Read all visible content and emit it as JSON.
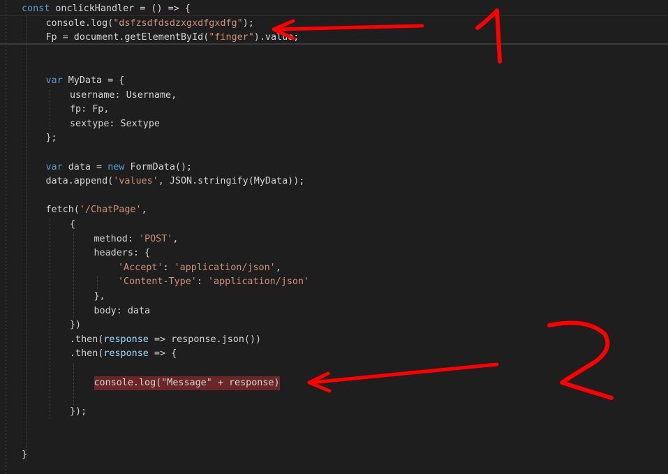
{
  "editor": {
    "lines": [
      {
        "indent": 0,
        "tokens": [
          {
            "t": "const ",
            "c": "kw"
          },
          {
            "t": "onclickHandler = () => {",
            "c": ""
          }
        ]
      },
      {
        "indent": 1,
        "tokens": [
          {
            "t": "console.log(",
            "c": ""
          },
          {
            "t": "\"dsfzsdfdsdzxgxdfgxdfg\"",
            "c": "str"
          },
          {
            "t": ");",
            "c": ""
          }
        ]
      },
      {
        "indent": 1,
        "tokens": [
          {
            "t": "Fp = document.getElementById(",
            "c": ""
          },
          {
            "t": "\"finger\"",
            "c": "str"
          },
          {
            "t": ").value;",
            "c": ""
          }
        ]
      },
      {
        "indent": 0,
        "tokens": []
      },
      {
        "indent": 0,
        "tokens": []
      },
      {
        "indent": 1,
        "tokens": [
          {
            "t": "var ",
            "c": "kw"
          },
          {
            "t": "MyData = {",
            "c": ""
          }
        ]
      },
      {
        "indent": 2,
        "tokens": [
          {
            "t": "username: Username,",
            "c": ""
          }
        ]
      },
      {
        "indent": 2,
        "tokens": [
          {
            "t": "fp: Fp,",
            "c": ""
          }
        ]
      },
      {
        "indent": 2,
        "tokens": [
          {
            "t": "sextype: Sextype",
            "c": ""
          }
        ]
      },
      {
        "indent": 1,
        "tokens": [
          {
            "t": "};",
            "c": ""
          }
        ]
      },
      {
        "indent": 0,
        "tokens": []
      },
      {
        "indent": 1,
        "tokens": [
          {
            "t": "var ",
            "c": "kw"
          },
          {
            "t": "data = ",
            "c": ""
          },
          {
            "t": "new ",
            "c": "kw"
          },
          {
            "t": "FormData();",
            "c": ""
          }
        ]
      },
      {
        "indent": 1,
        "tokens": [
          {
            "t": "data.append(",
            "c": ""
          },
          {
            "t": "'values'",
            "c": "str"
          },
          {
            "t": ", JSON.stringify(MyData));",
            "c": ""
          }
        ]
      },
      {
        "indent": 0,
        "tokens": []
      },
      {
        "indent": 1,
        "tokens": [
          {
            "t": "fetch(",
            "c": ""
          },
          {
            "t": "'/ChatPage'",
            "c": "str"
          },
          {
            "t": ",",
            "c": ""
          }
        ]
      },
      {
        "indent": 2,
        "tokens": [
          {
            "t": "{",
            "c": ""
          }
        ]
      },
      {
        "indent": 3,
        "tokens": [
          {
            "t": "method: ",
            "c": ""
          },
          {
            "t": "'POST'",
            "c": "str"
          },
          {
            "t": ",",
            "c": ""
          }
        ]
      },
      {
        "indent": 3,
        "tokens": [
          {
            "t": "headers: {",
            "c": ""
          }
        ]
      },
      {
        "indent": 4,
        "tokens": [
          {
            "t": "'Accept'",
            "c": "str"
          },
          {
            "t": ": ",
            "c": ""
          },
          {
            "t": "'application/json'",
            "c": "str"
          },
          {
            "t": ",",
            "c": ""
          }
        ]
      },
      {
        "indent": 4,
        "tokens": [
          {
            "t": "'Content-Type'",
            "c": "str"
          },
          {
            "t": ": ",
            "c": ""
          },
          {
            "t": "'application/json'",
            "c": "str"
          }
        ]
      },
      {
        "indent": 3,
        "tokens": [
          {
            "t": "},",
            "c": ""
          }
        ]
      },
      {
        "indent": 3,
        "tokens": [
          {
            "t": "body: data",
            "c": ""
          }
        ]
      },
      {
        "indent": 2,
        "tokens": [
          {
            "t": "})",
            "c": ""
          }
        ]
      },
      {
        "indent": 2,
        "tokens": [
          {
            "t": ".then(",
            "c": ""
          },
          {
            "t": "response",
            "c": "id"
          },
          {
            "t": " => response.json())",
            "c": ""
          }
        ]
      },
      {
        "indent": 2,
        "tokens": [
          {
            "t": ".then(",
            "c": ""
          },
          {
            "t": "response",
            "c": "id"
          },
          {
            "t": " => {",
            "c": ""
          }
        ]
      },
      {
        "indent": 0,
        "tokens": []
      },
      {
        "indent": 3,
        "highlight": true,
        "tokens": [
          {
            "t": "console.log(\"Message\" + response)",
            "c": ""
          }
        ]
      },
      {
        "indent": 0,
        "tokens": []
      },
      {
        "indent": 2,
        "tokens": [
          {
            "t": "});",
            "c": ""
          }
        ]
      },
      {
        "indent": 0,
        "tokens": []
      },
      {
        "indent": 0,
        "tokens": []
      },
      {
        "indent": 0,
        "tokens": [
          {
            "t": "}",
            "c": ""
          }
        ]
      }
    ]
  },
  "annotations": {
    "label_1": "1",
    "label_2": "2",
    "color": "#ff0000"
  }
}
